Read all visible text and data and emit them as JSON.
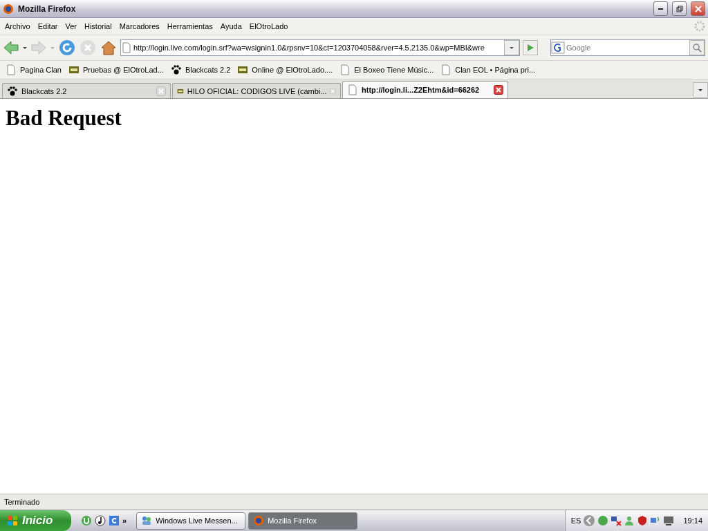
{
  "window": {
    "title": "Mozilla Firefox"
  },
  "menu": [
    "Archivo",
    "Editar",
    "Ver",
    "Historial",
    "Marcadores",
    "Herramientas",
    "Ayuda",
    "ElOtroLado"
  ],
  "address": {
    "value": "http://login.live.com/login.srf?wa=wsignin1.0&rpsnv=10&ct=1203704058&rver=4.5.2135.0&wp=MBI&wre"
  },
  "search": {
    "placeholder": "Google"
  },
  "bookmarks": [
    {
      "label": "Pagina Clan",
      "kind": "page"
    },
    {
      "label": "Pruebas @ ElOtroLad...",
      "kind": "eol"
    },
    {
      "label": "Blackcats 2.2",
      "kind": "paw"
    },
    {
      "label": "Online @ ElOtroLado....",
      "kind": "eol"
    },
    {
      "label": "El Boxeo Tiene Músic...",
      "kind": "page"
    },
    {
      "label": "Clan EOL • Página pri...",
      "kind": "page"
    }
  ],
  "tabs": [
    {
      "label": "Blackcats 2.2",
      "kind": "paw",
      "selected": false
    },
    {
      "label": "HILO OFICIAL: CODIGOS LIVE (cambi...",
      "kind": "eol",
      "selected": false
    },
    {
      "label": "http://login.li...Z2Ehtm&id=66262",
      "kind": "page",
      "selected": true
    }
  ],
  "content": {
    "heading": "Bad Request"
  },
  "status_bar": "Terminado",
  "taskbar": {
    "start": "Inicio",
    "more": "»",
    "buttons": [
      {
        "label": "Windows Live Messen...",
        "kind": "messenger",
        "selected": false
      },
      {
        "label": "Mozilla Firefox",
        "kind": "firefox",
        "selected": true
      }
    ],
    "language": "ES",
    "clock": "19:14"
  }
}
